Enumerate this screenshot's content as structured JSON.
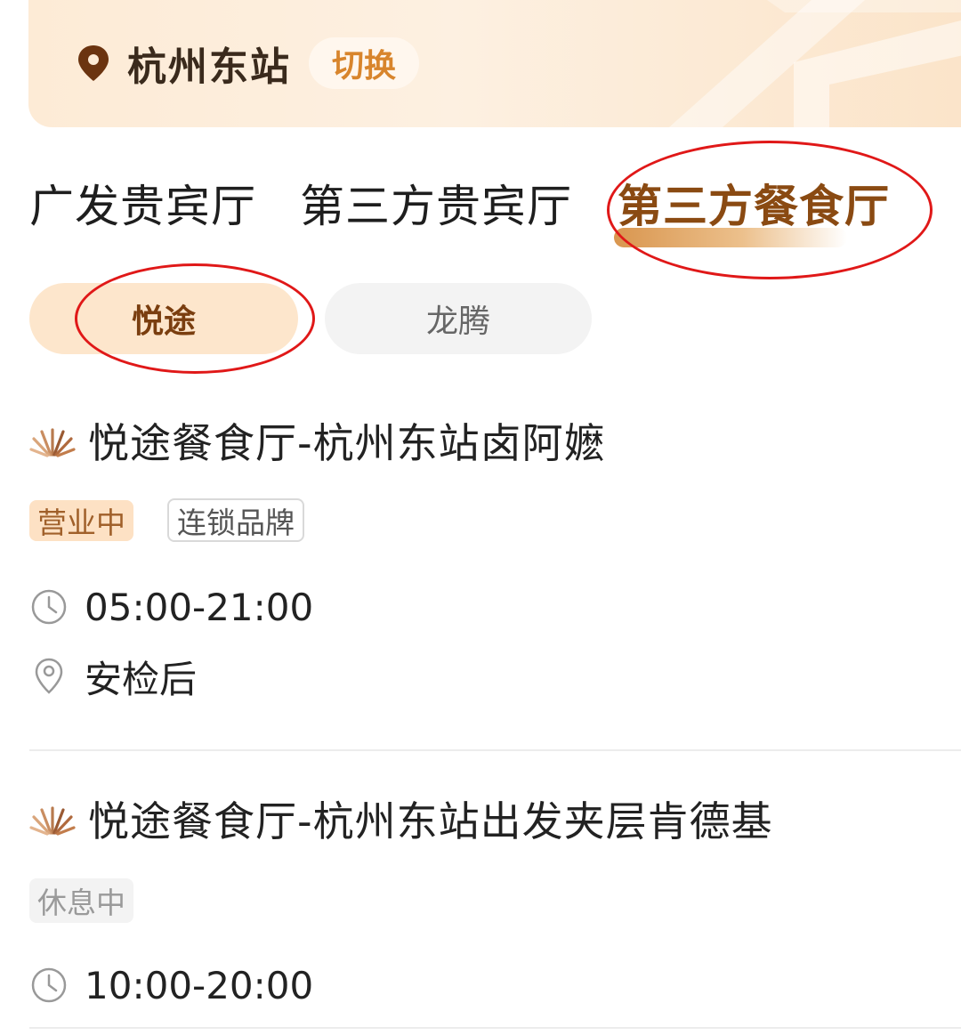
{
  "header": {
    "location_icon": "location-pin-icon",
    "station_name": "杭州东站",
    "switch_label": "切换"
  },
  "main_tabs": [
    {
      "label": "广发贵宾厅",
      "active": false
    },
    {
      "label": "第三方贵宾厅",
      "active": false
    },
    {
      "label": "第三方餐食厅",
      "active": true
    }
  ],
  "sub_tabs": [
    {
      "label": "悦途",
      "active": true
    },
    {
      "label": "龙腾",
      "active": false
    }
  ],
  "restaurants": [
    {
      "brand_icon": "yuetu-brand-icon",
      "name": "悦途餐食厅-杭州东站卤阿嬷",
      "tags": [
        "营业中",
        "连锁品牌"
      ],
      "hours": "05:00-21:00",
      "location": "安检后"
    },
    {
      "brand_icon": "yuetu-brand-icon",
      "name": "悦途餐食厅-杭州东站出发夹层肯德基",
      "tags": [
        "休息中"
      ],
      "hours": "10:00-20:00"
    }
  ],
  "colors": {
    "accent": "#8a4a12",
    "annotation": "#e01818",
    "open_tag_bg": "#fde1c4",
    "switch_text": "#d8852c"
  }
}
